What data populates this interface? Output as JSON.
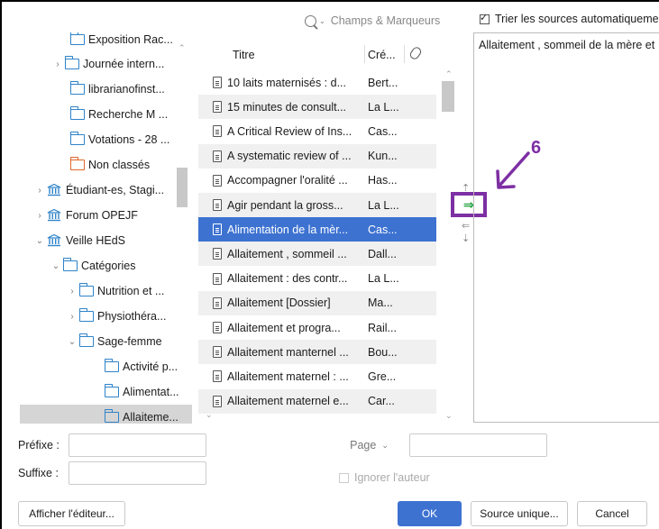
{
  "search": {
    "placeholder": "Champs & Marqueurs"
  },
  "sort_sources": {
    "label": "Trier les sources automatiquement",
    "checked": true
  },
  "tree": {
    "items": [
      {
        "label": "Exposition Rac...",
        "icon": "folder-icon",
        "expand": ""
      },
      {
        "label": "Journée intern...",
        "icon": "folder-icon",
        "expand": "›"
      },
      {
        "label": "librarianofinst...",
        "icon": "folder-icon",
        "expand": ""
      },
      {
        "label": "Recherche M ...",
        "icon": "folder-icon",
        "expand": ""
      },
      {
        "label": "Votations - 28 ...",
        "icon": "folder-icon",
        "expand": ""
      },
      {
        "label": "Non classés",
        "icon": "unfiled-folder-icon",
        "expand": ""
      },
      {
        "label": "Étudiant-es, Stagi...",
        "icon": "library-icon",
        "expand": "›"
      },
      {
        "label": "Forum OPEJF",
        "icon": "library-icon",
        "expand": "›"
      },
      {
        "label": "Veille HEdS",
        "icon": "library-icon",
        "expand": "⌄"
      },
      {
        "label": "Catégories",
        "icon": "folder-icon",
        "expand": "⌄"
      },
      {
        "label": "Nutrition et ...",
        "icon": "folder-icon",
        "expand": "›"
      },
      {
        "label": "Physiothéra...",
        "icon": "folder-icon",
        "expand": "›"
      },
      {
        "label": "Sage-femme",
        "icon": "folder-icon",
        "expand": "⌄"
      },
      {
        "label": "Activité p...",
        "icon": "folder-icon",
        "expand": ""
      },
      {
        "label": "Alimentat...",
        "icon": "folder-icon",
        "expand": ""
      },
      {
        "label": "Allaiteme...",
        "icon": "folder-icon",
        "expand": ""
      }
    ]
  },
  "list": {
    "col_title": "Titre",
    "col_creator": "Cré...",
    "items": [
      {
        "title": "10 laits maternisés : d...",
        "creator": "Bert..."
      },
      {
        "title": "15 minutes de consult...",
        "creator": "La L..."
      },
      {
        "title": "A Critical Review of Ins...",
        "creator": "Cas..."
      },
      {
        "title": "A systematic review of ...",
        "creator": "Kun..."
      },
      {
        "title": "Accompagner l'oralité ...",
        "creator": "Has..."
      },
      {
        "title": "Agir pendant la gross...",
        "creator": "La L..."
      },
      {
        "title": "Alimentation de la mèr...",
        "creator": "Cas..."
      },
      {
        "title": "Allaitement , sommeil ...",
        "creator": "Dall..."
      },
      {
        "title": "Allaitement : des contr...",
        "creator": "La L..."
      },
      {
        "title": "Allaitement [Dossier]",
        "creator": "Ma..."
      },
      {
        "title": "Allaitement et progra...",
        "creator": "Rail..."
      },
      {
        "title": "Allaitement manternel ...",
        "creator": "Bou..."
      },
      {
        "title": "Allaitement maternel : ...",
        "creator": "Gre..."
      },
      {
        "title": "Allaitement maternel e...",
        "creator": "Car..."
      }
    ]
  },
  "preview_text": "Allaitement , sommeil de la mère et",
  "annotation": {
    "number": "6",
    "color": "#7d2fa4"
  },
  "form": {
    "prefix_label": "Préfixe :",
    "suffix_label": "Suffixe :",
    "page_label": "Page",
    "ignore_author": "Ignorer l'auteur"
  },
  "buttons": {
    "show_editor": "Afficher l'éditeur...",
    "ok": "OK",
    "single_source": "Source unique...",
    "cancel": "Cancel"
  },
  "colors": {
    "selection": "#3d72d1",
    "folder": "#2f83c9",
    "unfiled": "#e0682a",
    "move_arrow": "#2fa84c"
  }
}
